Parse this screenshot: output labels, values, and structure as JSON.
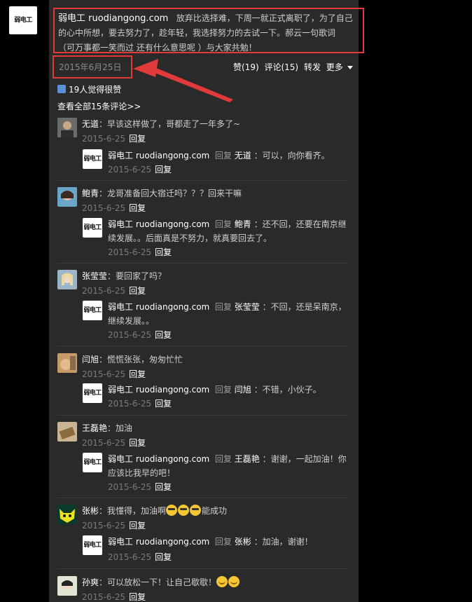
{
  "post": {
    "author": "弱电工 ruodiangong.com",
    "line1": "放弃比选择难，下周一就正式离职了，为了自己",
    "line2": "的心中所想，要去努力了，趁年轻，我选择努力的去试一下。郝云一句歌词",
    "line3": "（可万事都一笑而过 还有什么意思呢 ）与大家共勉！",
    "date": "2015年6月25日",
    "logo_text": "弱电工"
  },
  "actions": {
    "like": "赞(19)",
    "comment": "评论(15)",
    "share": "转发",
    "more": "更多"
  },
  "likes_text": "19人觉得很赞",
  "view_all": "查看全部15条评论>>",
  "comments": [
    {
      "name": "无道",
      "text": "：早该这样做了，哥都走了一年多了~",
      "date": "2015-6-25",
      "reply_label": "回复",
      "sub": {
        "author": "弱电工 ruodiangong.com",
        "reply_to_label": "回复",
        "reply_to": "无道",
        "line1": "：可以，向你看齐。",
        "line2": "",
        "date": "2015-6-25",
        "reply_label": "回复"
      }
    },
    {
      "name": "鲍青",
      "text": "：龙哥准备回大宿迁吗？？？回来干嘛",
      "date": "2015-6-25",
      "reply_label": "回复",
      "sub": {
        "author": "弱电工 ruodiangong.com",
        "reply_to_label": "回复",
        "reply_to": "鲍青",
        "line1": "：还不回，还要在南京继",
        "line2": "续发展。。后面真是不努力，就真要回去了。",
        "date": "2015-6-25",
        "reply_label": "回复"
      }
    },
    {
      "name": "张莹莹",
      "text": "：要回家了吗？",
      "date": "2015-6-25",
      "reply_label": "回复",
      "sub": {
        "author": "弱电工 ruodiangong.com",
        "reply_to_label": "回复",
        "reply_to": "张莹莹",
        "line1": "：不回，还是呆南京，",
        "line2": "继续发展。。",
        "date": "2015-6-25",
        "reply_label": "回复"
      }
    },
    {
      "name": "闫旭",
      "text": "：慌慌张张，匆匆忙忙",
      "date": "2015-6-25",
      "reply_label": "回复",
      "sub": {
        "author": "弱电工 ruodiangong.com",
        "reply_to_label": "回复",
        "reply_to": "闫旭",
        "line1": "：不错，小伙子。",
        "line2": "",
        "date": "2015-6-25",
        "reply_label": "回复"
      }
    },
    {
      "name": "王磊艳",
      "text": "：加油",
      "date": "2015-6-25",
      "reply_label": "回复",
      "sub": {
        "author": "弱电工 ruodiangong.com",
        "reply_to_label": "回复",
        "reply_to": "王磊艳",
        "line1": "：谢谢，一起加油！你",
        "line2": "应该比我早的吧！",
        "date": "2015-6-25",
        "reply_label": "回复"
      }
    },
    {
      "name": "张彬",
      "text_before": "：我懂得，加油啊",
      "text_after": "能成功",
      "date": "2015-6-25",
      "reply_label": "回复",
      "sub": {
        "author": "弱电工 ruodiangong.com",
        "reply_to_label": "回复",
        "reply_to": "张彬",
        "line1": "：加油，谢谢！",
        "line2": "",
        "date": "2015-6-25",
        "reply_label": "回复"
      }
    },
    {
      "name": "孙爽",
      "text": "：可以放松一下！让自己歇歇！",
      "date": "2015-6-25",
      "reply_label": "回复"
    }
  ],
  "colors": {
    "annotation_red": "#e23a3a",
    "panel_bg": "#2a2a2a",
    "page_bg": "#000000"
  }
}
